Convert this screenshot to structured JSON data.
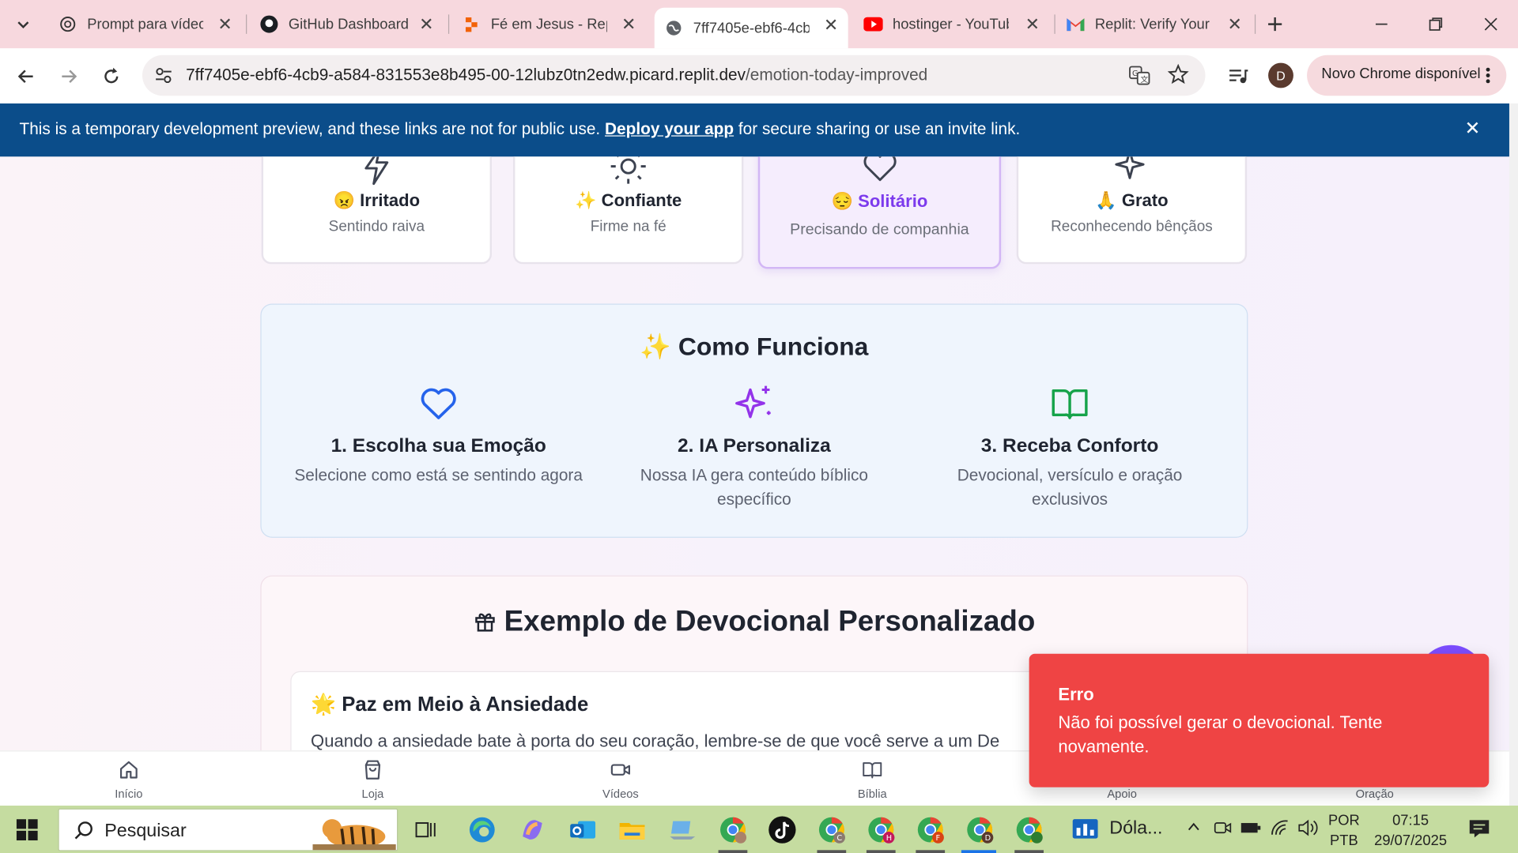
{
  "tabs": [
    {
      "title": "Prompt para vídeo",
      "icon": "openai-icon"
    },
    {
      "title": "GitHub Dashboard",
      "icon": "github-icon"
    },
    {
      "title": "Fé em Jesus - Repl",
      "icon": "replit-icon"
    },
    {
      "title": "7ff7405e-ebf6-4cb",
      "icon": "globe-icon",
      "active": true
    },
    {
      "title": "hostinger - YouTub",
      "icon": "youtube-icon"
    },
    {
      "title": "Replit: Verify Your",
      "icon": "gmail-icon"
    }
  ],
  "toolbar": {
    "url_host": "7ff7405e-ebf6-4cb9-a584-831553e8b495-00-12lubz0tn2edw.picard.replit.dev",
    "url_path": "/emotion-today-improved",
    "profile_initial": "D",
    "update_label": "Novo Chrome disponível"
  },
  "banner": {
    "text_before": "This is a temporary development preview, and these links are not for public use. ",
    "link": "Deploy your app",
    "text_after": " for secure sharing or use an invite link."
  },
  "emotions": [
    {
      "emoji": "😠",
      "title": "Irritado",
      "subtitle": "Sentindo raiva"
    },
    {
      "emoji": "✨",
      "title": "Confiante",
      "subtitle": "Firme na fé"
    },
    {
      "emoji": "😔",
      "title": "Solitário",
      "subtitle": "Precisando de companhia",
      "selected": true
    },
    {
      "emoji": "🙏",
      "title": "Grato",
      "subtitle": "Reconhecendo bênçãos"
    }
  ],
  "how_it_works": {
    "emoji": "✨",
    "title": "Como Funciona",
    "steps": [
      {
        "title": "1. Escolha sua Emoção",
        "desc": "Selecione como está se sentindo agora",
        "icon": "heart-icon",
        "color": "#2563eb"
      },
      {
        "title": "2. IA Personaliza",
        "desc": "Nossa IA gera conteúdo bíblico específico",
        "icon": "sparkles-icon",
        "color": "#9333ea"
      },
      {
        "title": "3. Receba Conforto",
        "desc": "Devocional, versículo e oração exclusivos",
        "icon": "book-open-icon",
        "color": "#16a34a"
      }
    ]
  },
  "example": {
    "title": "Exemplo de Devocional Personalizado",
    "card_emoji": "🌟",
    "card_title": "Paz em Meio à Ansiedade",
    "card_text": "Quando a ansiedade bate à porta do seu coração, lembre-se de que você serve a um De"
  },
  "bottom_nav": [
    {
      "label": "Início",
      "icon": "home-icon"
    },
    {
      "label": "Loja",
      "icon": "shopping-bag-icon"
    },
    {
      "label": "Vídeos",
      "icon": "video-icon"
    },
    {
      "label": "Bíblia",
      "icon": "book-icon"
    },
    {
      "label": "Apoio",
      "icon": "hand-heart-icon"
    },
    {
      "label": "Oração",
      "icon": "prayer-icon"
    }
  ],
  "toast": {
    "title": "Erro",
    "message": "Não foi possível gerar o devocional. Tente novamente.",
    "color": "#ef4444"
  },
  "taskbar": {
    "search_placeholder": "Pesquisar",
    "pinned_label": "Dóla...",
    "lang_top": "POR",
    "lang_bottom": "PTB",
    "time": "07:15",
    "date": "29/07/2025"
  }
}
